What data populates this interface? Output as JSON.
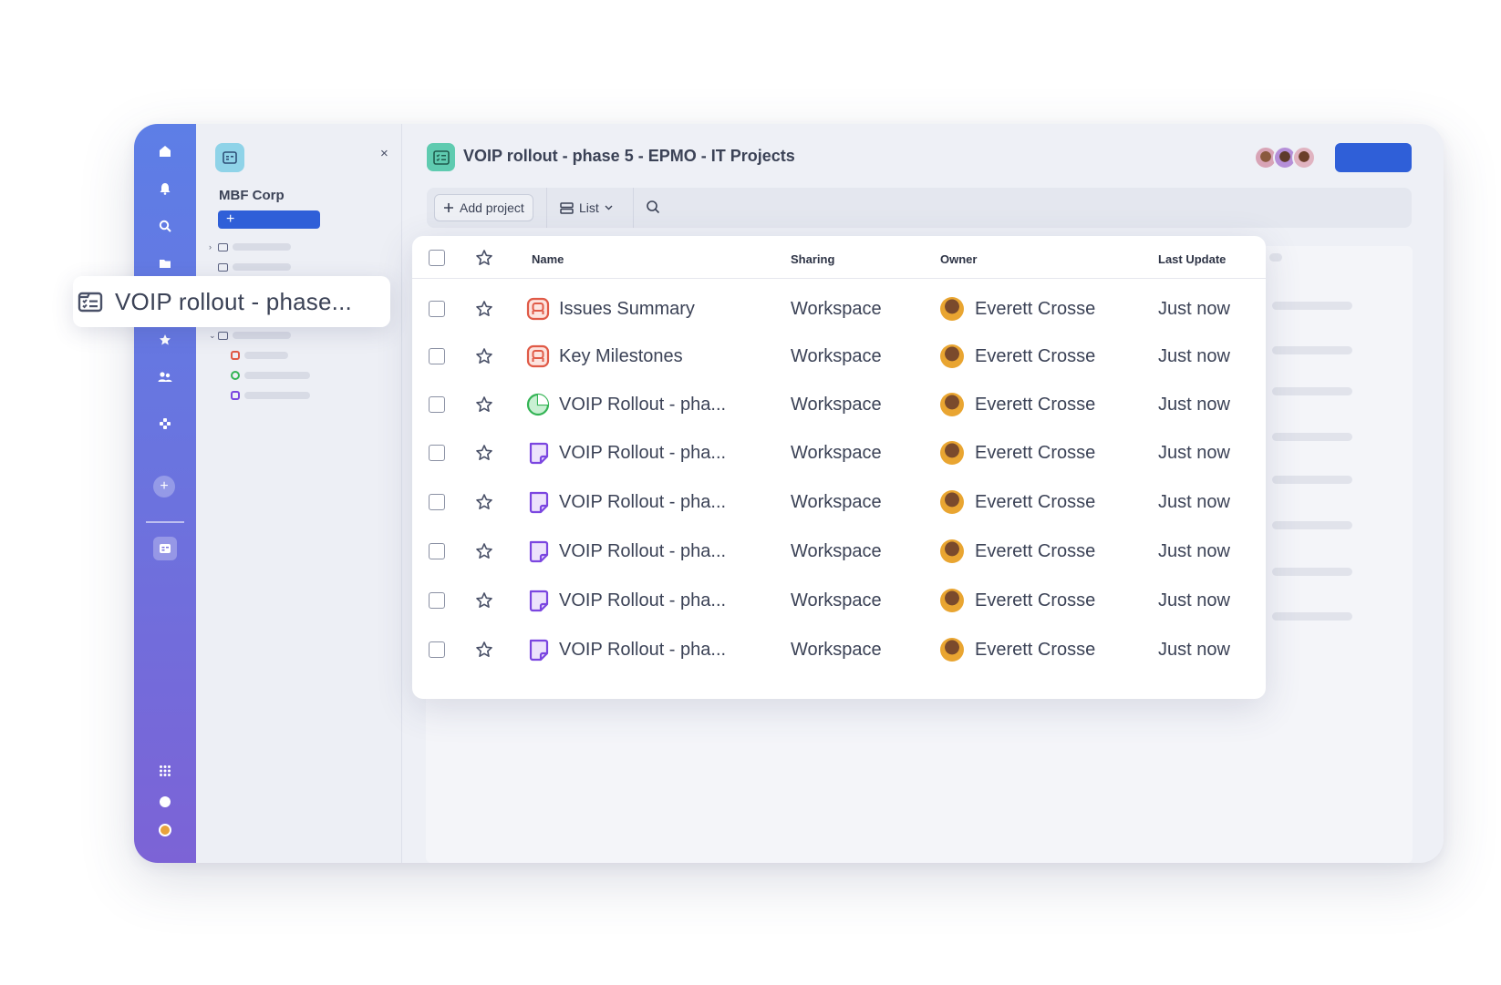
{
  "floating_chip": {
    "label": "VOIP rollout - phase..."
  },
  "sidebar": {
    "org_name": "MBF Corp",
    "new_button_label": "+",
    "close_label": "×"
  },
  "header": {
    "title": "VOIP rollout - phase 5 - EPMO - IT Projects"
  },
  "toolbar": {
    "add_project_label": "Add project",
    "view_label": "List"
  },
  "table": {
    "columns": {
      "name": "Name",
      "sharing": "Sharing",
      "owner": "Owner",
      "last_update": "Last Update"
    },
    "rows": [
      {
        "type": "issues",
        "name": "Issues Summary",
        "sharing": "Workspace",
        "owner": "Everett Crosse",
        "last_update": "Just now"
      },
      {
        "type": "issues",
        "name": "Key Milestones",
        "sharing": "Workspace",
        "owner": "Everett Crosse",
        "last_update": "Just now"
      },
      {
        "type": "pie",
        "name": "VOIP Rollout - pha...",
        "sharing": "Workspace",
        "owner": "Everett Crosse",
        "last_update": "Just now"
      },
      {
        "type": "doc",
        "name": "VOIP Rollout - pha...",
        "sharing": "Workspace",
        "owner": "Everett Crosse",
        "last_update": "Just now"
      },
      {
        "type": "doc",
        "name": "VOIP Rollout - pha...",
        "sharing": "Workspace",
        "owner": "Everett Crosse",
        "last_update": "Just now"
      },
      {
        "type": "doc",
        "name": "VOIP Rollout - pha...",
        "sharing": "Workspace",
        "owner": "Everett Crosse",
        "last_update": "Just now"
      },
      {
        "type": "doc",
        "name": "VOIP Rollout - pha...",
        "sharing": "Workspace",
        "owner": "Everett Crosse",
        "last_update": "Just now"
      },
      {
        "type": "doc",
        "name": "VOIP Rollout - pha...",
        "sharing": "Workspace",
        "owner": "Everett Crosse",
        "last_update": "Just now"
      }
    ]
  },
  "colors": {
    "accent": "#2f5fd8",
    "issues_icon": "#e05a47",
    "pie_icon": "#34b455",
    "doc_icon": "#7b46e0"
  }
}
